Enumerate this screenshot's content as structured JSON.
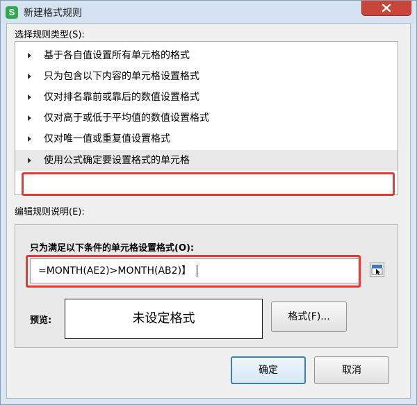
{
  "window": {
    "title": "新建格式规则",
    "app_icon_letter": "S"
  },
  "rule_type": {
    "section_label": "选择规则类型(S):",
    "items": [
      {
        "label": "基于各自值设置所有单元格的格式",
        "selected": false
      },
      {
        "label": "只为包含以下内容的单元格设置格式",
        "selected": false
      },
      {
        "label": "仅对排名靠前或靠后的数值设置格式",
        "selected": false
      },
      {
        "label": "仅对高于或低于平均值的数值设置格式",
        "selected": false
      },
      {
        "label": "仅对唯一值或重复值设置格式",
        "selected": false
      },
      {
        "label": "使用公式确定要设置格式的单元格",
        "selected": true
      }
    ]
  },
  "edit_rule": {
    "section_label": "编辑规则说明(E):",
    "condition_label": "只为满足以下条件的单元格设置格式(O):",
    "formula_value": "=MONTH(AE2)>MONTH(AB2)】",
    "preview_label": "预览:",
    "preview_text": "未设定格式",
    "format_button": "格式(F)..."
  },
  "buttons": {
    "ok": "确定",
    "cancel": "取消"
  },
  "colors": {
    "highlight_border": "#e53935",
    "close_button": "#c9453a",
    "app_icon": "#2fa84f"
  }
}
